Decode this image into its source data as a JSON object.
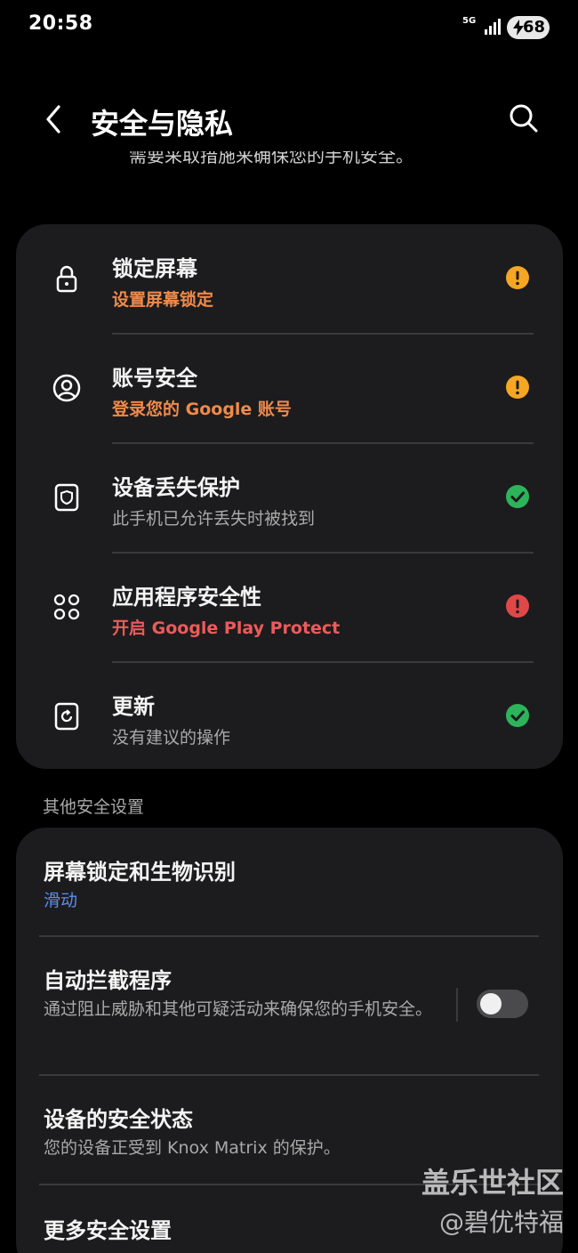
{
  "status_bar": {
    "time": "20:58",
    "network": "5G",
    "battery_level": "68"
  },
  "header": {
    "title": "安全与隐私",
    "partial_text": "需要采取措施来确保您的手机安全。"
  },
  "security_items": [
    {
      "title": "锁定屏幕",
      "subtitle": "设置屏幕锁定",
      "status": "warning",
      "icon": "lock-icon"
    },
    {
      "title": "账号安全",
      "subtitle": "登录您的 Google 账号",
      "status": "warning",
      "icon": "account-icon"
    },
    {
      "title": "设备丢失保护",
      "subtitle": "此手机已允许丢失时被找到",
      "status": "ok",
      "icon": "shield-icon"
    },
    {
      "title": "应用程序安全性",
      "subtitle": "开启 Google Play Protect",
      "status": "danger",
      "icon": "apps-icon"
    },
    {
      "title": "更新",
      "subtitle": "没有建议的操作",
      "status": "ok",
      "icon": "update-icon"
    }
  ],
  "other_section": {
    "label": "其他安全设置",
    "items": [
      {
        "title": "屏幕锁定和生物识别",
        "subtitle": "滑动"
      },
      {
        "title": "自动拦截程序",
        "subtitle": "通过阻止威胁和其他可疑活动来确保您的手机安全。",
        "toggle": "off"
      },
      {
        "title": "设备的安全状态",
        "subtitle": "您的设备正受到 Knox Matrix 的保护。"
      },
      {
        "title": "更多安全设置"
      }
    ]
  },
  "watermark": {
    "line1": "盖乐世社区",
    "line2": "@碧优特福"
  },
  "colors": {
    "background": "#000000",
    "card": "#1c1c1e",
    "warning_icon": "#f5a623",
    "warning_text": "#f08a4b",
    "danger": "#e04848",
    "ok": "#2db45a",
    "link_blue": "#5b8def"
  }
}
